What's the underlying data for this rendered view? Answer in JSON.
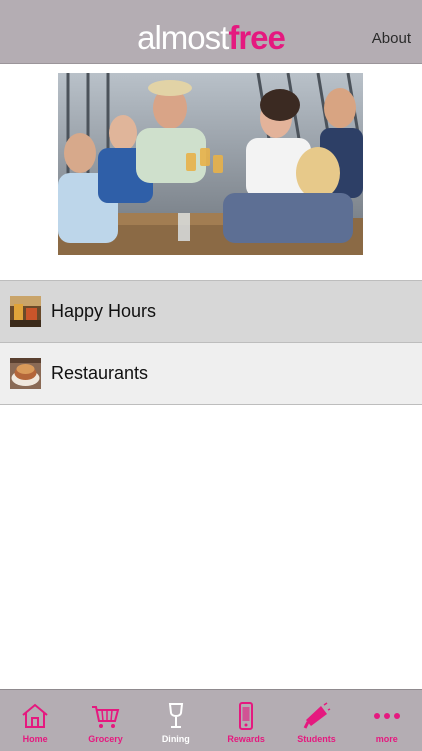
{
  "header": {
    "logo_part1": "almost",
    "logo_part2": "free",
    "about_label": "About"
  },
  "list": {
    "items": [
      {
        "label": "Happy Hours",
        "icon": "beer-thumbnail-icon"
      },
      {
        "label": "Restaurants",
        "icon": "food-thumbnail-icon"
      }
    ]
  },
  "tabbar": {
    "tabs": [
      {
        "label": "Home",
        "icon": "home-icon"
      },
      {
        "label": "Grocery",
        "icon": "cart-icon"
      },
      {
        "label": "Dining",
        "icon": "wine-glass-icon",
        "active": true
      },
      {
        "label": "Rewards",
        "icon": "phone-icon"
      },
      {
        "label": "Students",
        "icon": "megaphone-icon"
      },
      {
        "label": "more",
        "icon": "more-icon"
      }
    ]
  },
  "colors": {
    "bar_background": "#b4adb3",
    "brand_pink": "#e5197f",
    "active_tab_label": "#ffffff",
    "selected_row": "#d7d7d7"
  }
}
